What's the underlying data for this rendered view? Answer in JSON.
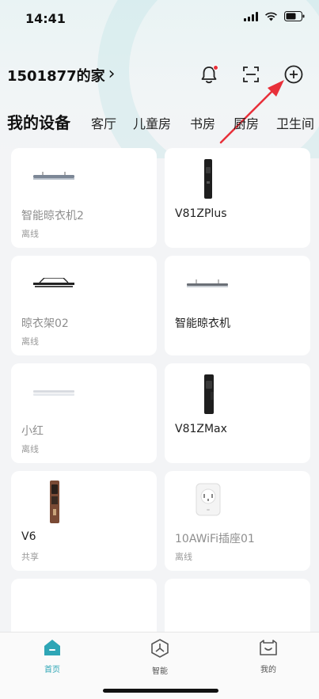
{
  "status_bar": {
    "time": "14:41"
  },
  "header": {
    "home_name": "1501877的家",
    "chevron": "›"
  },
  "tabs": [
    {
      "label": "我的设备",
      "active": true
    },
    {
      "label": "客厅"
    },
    {
      "label": "儿童房"
    },
    {
      "label": "书房"
    },
    {
      "label": "厨房"
    },
    {
      "label": "卫生间"
    }
  ],
  "devices": [
    {
      "name": "智能晾衣机2",
      "status": "离线",
      "icon": "clothes-rack-icon"
    },
    {
      "name": "V81ZPlus",
      "status": "",
      "icon": "smart-lock-icon"
    },
    {
      "name": "晾衣架02",
      "status": "离线",
      "icon": "clothes-rack-icon"
    },
    {
      "name": "智能晾衣机",
      "status": "",
      "icon": "clothes-rack-icon"
    },
    {
      "name": "小红",
      "status": "离线",
      "icon": "clothes-rack-icon"
    },
    {
      "name": "V81ZMax",
      "status": "",
      "icon": "smart-lock-icon"
    },
    {
      "name": "V6",
      "status": "共享",
      "icon": "smart-lock-icon"
    },
    {
      "name": "10AWiFi插座01",
      "status": "离线",
      "icon": "socket-icon"
    }
  ],
  "bottom_nav": [
    {
      "label": "首页",
      "icon": "home-icon",
      "active": true
    },
    {
      "label": "智能",
      "icon": "smart-hex-icon"
    },
    {
      "label": "我的",
      "icon": "profile-icon"
    }
  ],
  "colors": {
    "accent": "#2ea6b6",
    "notification_dot": "#e8303a",
    "annotation_arrow": "#e8303a"
  }
}
